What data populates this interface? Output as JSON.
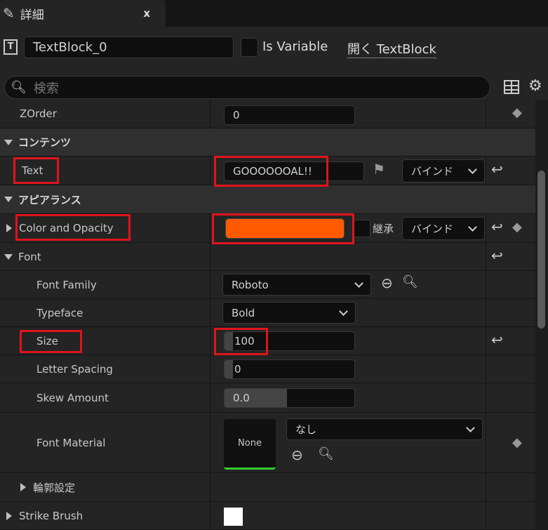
{
  "tab": {
    "title": "詳細",
    "close": "x",
    "icon": "details-pencil-icon"
  },
  "header": {
    "name_value": "TextBlock_0",
    "is_variable_label": "Is Variable",
    "is_variable_checked": false,
    "open_link": "開く TextBlock"
  },
  "search": {
    "placeholder": "検索"
  },
  "rows": {
    "zorder": {
      "label": "ZOrder",
      "value": "0"
    },
    "content_header": "コンテンツ",
    "text": {
      "label": "Text",
      "value": "GOOOOOOAL!!",
      "bind": "バインド"
    },
    "appearance_header": "アピアランス",
    "color": {
      "label": "Color and Opacity",
      "color": "#FF5A00",
      "inherit": "継承",
      "bind": "バインド"
    },
    "font": {
      "label": "Font"
    },
    "font_family": {
      "label": "Font Family",
      "value": "Roboto"
    },
    "typeface": {
      "label": "Typeface",
      "value": "Bold"
    },
    "size": {
      "label": "Size",
      "value": "100"
    },
    "letter_spacing": {
      "label": "Letter Spacing",
      "value": "0"
    },
    "skew": {
      "label": "Skew Amount",
      "value": "0.0"
    },
    "font_material": {
      "label": "Font Material",
      "thumb": "None",
      "value": "なし"
    },
    "outline": {
      "label": "輪郭設定"
    },
    "strike": {
      "label": "Strike Brush",
      "color": "#FFFFFF"
    }
  },
  "highlight_color": "#E0141C"
}
